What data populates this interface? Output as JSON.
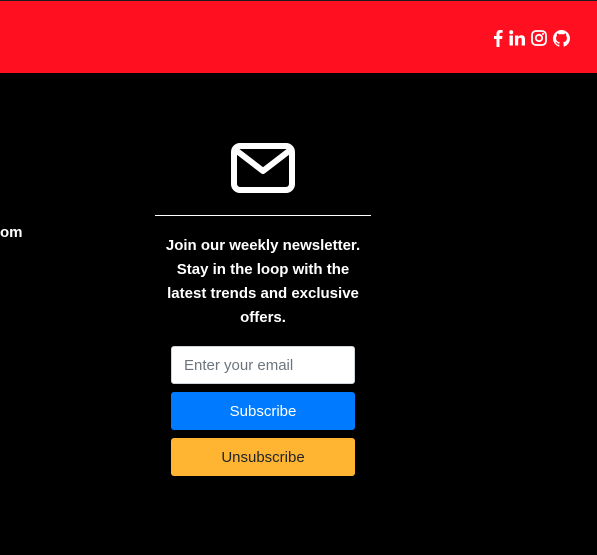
{
  "header": {
    "background": "#ff0f1f",
    "social_icons": [
      "facebook-icon",
      "linkedin-icon",
      "instagram-icon",
      "github-icon"
    ]
  },
  "footer": {
    "left_fragment_text": "om",
    "newsletter": {
      "icon": "envelope-icon",
      "blurb": "Join our weekly newsletter. Stay in the loop with the latest trends and exclusive offers.",
      "email_placeholder": "Enter your email",
      "email_value": "",
      "subscribe_label": "Subscribe",
      "unsubscribe_label": "Unsubscribe"
    }
  },
  "colors": {
    "accent_red": "#ff0f1f",
    "subscribe_blue": "#007bff",
    "unsubscribe_yellow": "#ffb531",
    "background": "#000000"
  }
}
